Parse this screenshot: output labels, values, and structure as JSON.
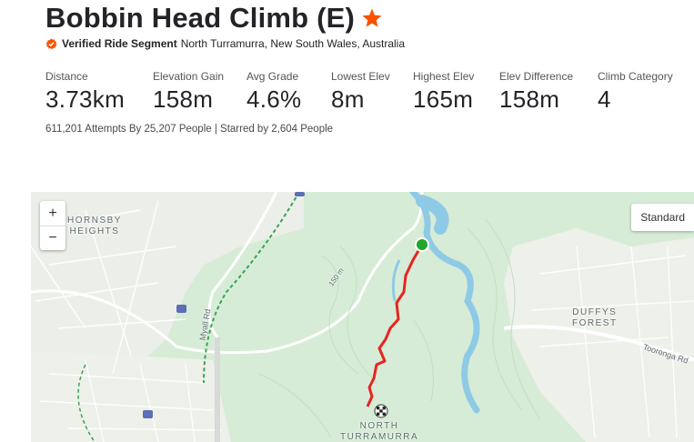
{
  "segment": {
    "title": "Bobbin Head Climb (E)",
    "verified_label": "Verified Ride Segment",
    "location": "North Turramurra, New South Wales, Australia"
  },
  "stats": [
    {
      "label": "Distance",
      "value": "3.73km"
    },
    {
      "label": "Elevation Gain",
      "value": "158m"
    },
    {
      "label": "Avg Grade",
      "value": "4.6%"
    },
    {
      "label": "Lowest Elev",
      "value": "8m"
    },
    {
      "label": "Highest Elev",
      "value": "165m"
    },
    {
      "label": "Elev Difference",
      "value": "158m"
    },
    {
      "label": "Climb Category",
      "value": "4"
    }
  ],
  "attempts_text": "611,201 Attempts By 25,207 People | Starred by 2,604 People",
  "map": {
    "zoom_in": "+",
    "zoom_out": "−",
    "style_button": "Standard",
    "labels": {
      "hornsby_1": "HORNSBY",
      "hornsby_2": "HEIGHTS",
      "duffys_1": "DUFFYS",
      "duffys_2": "FOREST",
      "north_1": "NORTH",
      "north_2": "TURRAMURRA",
      "myall": "Myall Rd",
      "tooronga": "Tooronga Rd",
      "contour": "150 m"
    }
  },
  "colors": {
    "brand_orange": "#fc5200",
    "route_red": "#e8241f",
    "start_green": "#21a62b",
    "water": "#8ecae6",
    "map_green": "#d6ecd6"
  }
}
